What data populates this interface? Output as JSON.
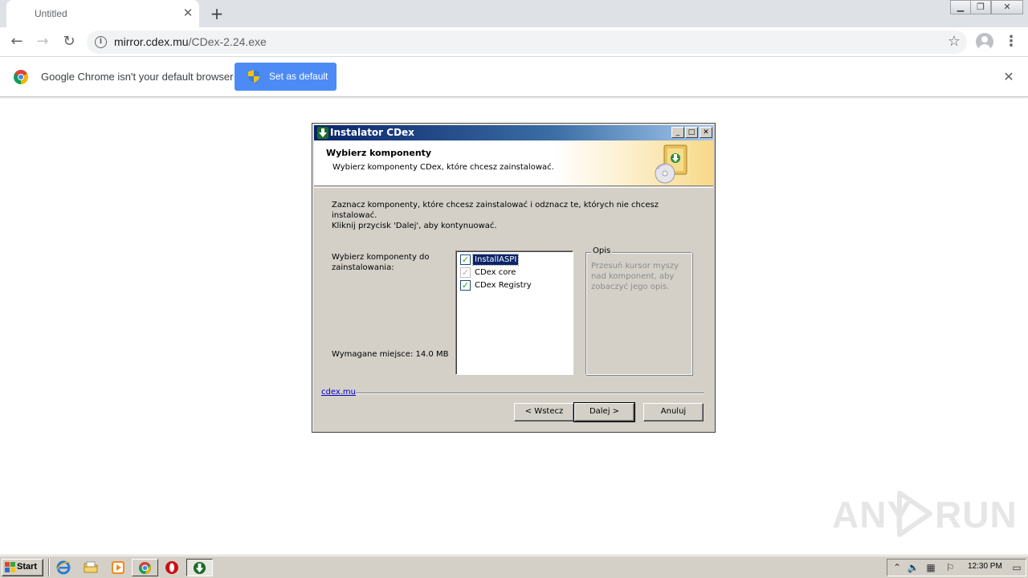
{
  "browser": {
    "tab_title": "Untitled",
    "url_host": "mirror.cdex.mu",
    "url_path": "/CDex-2.24.exe",
    "infobar_text": "Google Chrome isn't your default browser",
    "set_default_label": "Set as default"
  },
  "installer": {
    "window_title": "Instalator CDex",
    "header_title": "Wybierz komponenty",
    "header_subtitle": "Wybierz komponenty CDex, które chcesz zainstalować.",
    "instructions_line1": "Zaznacz komponenty, które chcesz zainstalować i odznacz te, których nie chcesz instalować.",
    "instructions_line2": "Kliknij przycisk 'Dalej', aby kontynuować.",
    "components_label": "Wybierz komponenty do zainstalowania:",
    "space_required": "Wymagane miejsce: 14.0 MB",
    "components": [
      {
        "label": "InstallASPI",
        "checked": true,
        "selected": true,
        "disabled": false
      },
      {
        "label": "CDex core",
        "checked": true,
        "selected": false,
        "disabled": true
      },
      {
        "label": "CDex Registry",
        "checked": true,
        "selected": false,
        "disabled": false
      }
    ],
    "description_title": "Opis",
    "description_text": "Przesuń kursor myszy nad komponent, aby zobaczyć jego opis.",
    "link_text": "cdex.mu",
    "back_button": "< Wstecz",
    "next_button": "Dalej >",
    "cancel_button": "Anuluj"
  },
  "watermark": {
    "left": "ANY",
    "right": "RUN"
  },
  "taskbar": {
    "start_label": "Start",
    "clock": "12:30 PM",
    "quick_launch": [
      "internet-explorer-icon",
      "folder-icon",
      "media-player-icon"
    ],
    "apps": [
      "chrome-icon",
      "opera-icon",
      "installer-icon"
    ]
  },
  "colors": {
    "title_gradient_start": "#0a246a",
    "dialog_face": "#d4d0c8",
    "chrome_button": "#4c8bf5"
  }
}
